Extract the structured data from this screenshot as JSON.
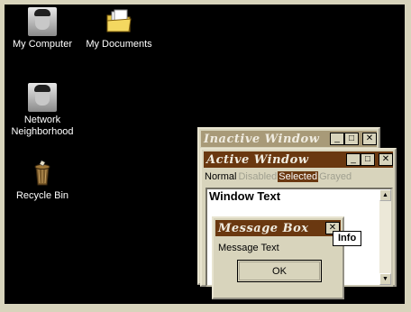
{
  "desktop": {
    "icons": [
      {
        "label": "My Computer",
        "icon": "my-computer-icon"
      },
      {
        "label": "My Documents",
        "icon": "folder-icon"
      },
      {
        "label": "Network\nNeighborhood",
        "icon": "network-neighborhood-icon"
      },
      {
        "label": "Recycle Bin",
        "icon": "recycle-bin-icon"
      }
    ]
  },
  "inactive_window": {
    "title": "Inactive Window",
    "buttons": {
      "minimize": "_",
      "maximize": "□",
      "close": "✕"
    }
  },
  "active_window": {
    "title": "Active Window",
    "buttons": {
      "minimize": "_",
      "maximize": "□",
      "close": "✕"
    },
    "menu": {
      "normal": "Normal",
      "disabled": "Disabled",
      "selected": "Selected",
      "grayed": "Grayed"
    },
    "window_text": "Window Text",
    "scroll_up": "▲",
    "scroll_down": "▼"
  },
  "message_box": {
    "title": "Message Box",
    "close": "✕",
    "text": "Message Text",
    "ok_label": "OK",
    "tooltip": "Info"
  },
  "colors": {
    "desktop": "#000000",
    "active_title": "#6a3810",
    "inactive_title": "#a89a78",
    "face": "#d8d4bc"
  }
}
